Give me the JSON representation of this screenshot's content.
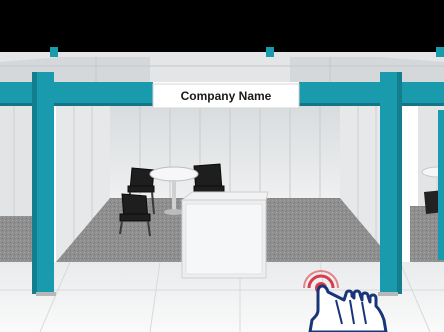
{
  "booth": {
    "sign_text": "Company Name",
    "accent_color": "#1a9aad",
    "top_bar_color": "#000000",
    "panel_color": "#eceeef",
    "carpet_color": "#8f8f8f",
    "floor_color": "#f4f5f6",
    "furniture": {
      "table": "round-white-table",
      "chairs": "black-chairs",
      "counter": "white-reception-counter"
    }
  },
  "tap_indicator": {
    "icon": "hand-tap-icon",
    "ring_color": "#d93d4a",
    "hand_color": "#19357a"
  }
}
